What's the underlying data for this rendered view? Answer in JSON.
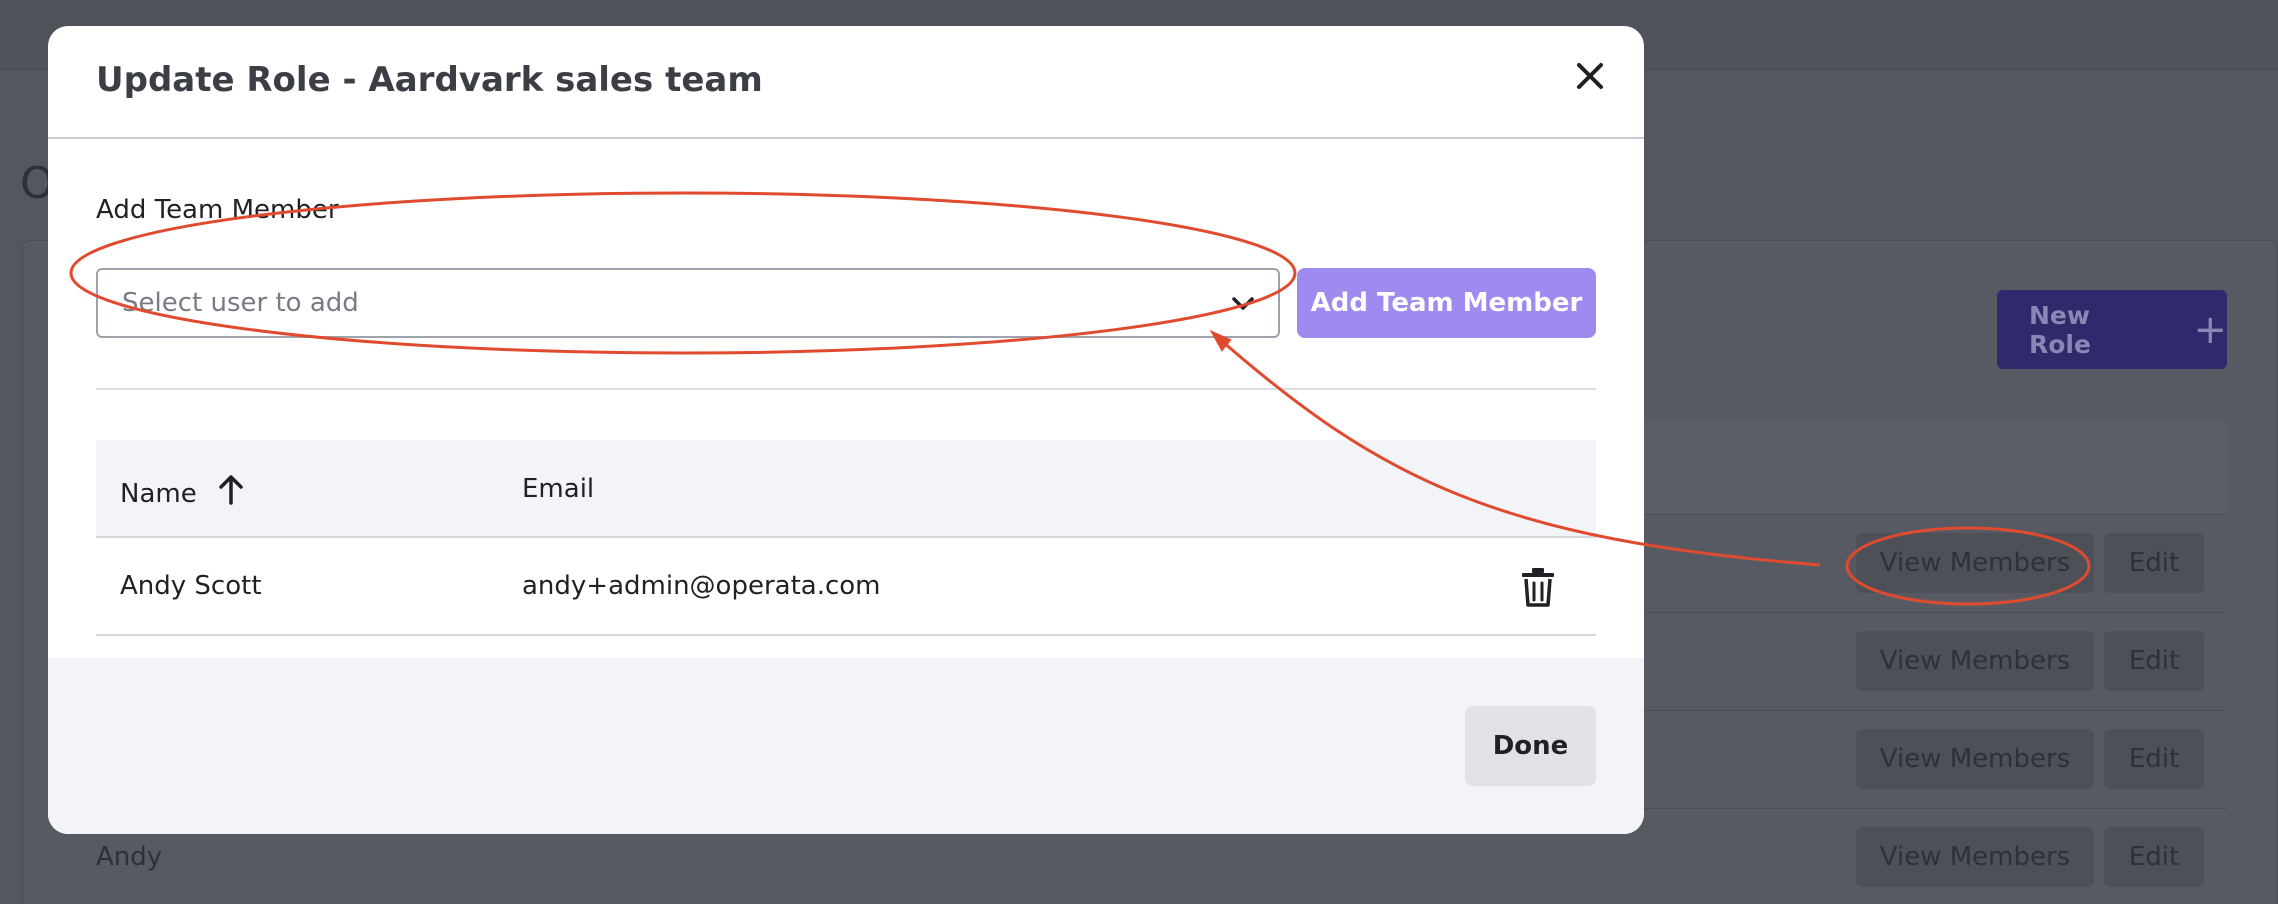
{
  "background": {
    "page_title_fragment": "O",
    "new_role_label": "New Role",
    "new_role_icon": "plus-icon",
    "rows": [
      {
        "name": "",
        "view_members_label": "View Members",
        "edit_label": "Edit"
      },
      {
        "name": "",
        "view_members_label": "View Members",
        "edit_label": "Edit"
      },
      {
        "name": "",
        "view_members_label": "View Members",
        "edit_label": "Edit"
      },
      {
        "name": "Andy",
        "view_members_label": "View Members",
        "edit_label": "Edit"
      }
    ]
  },
  "modal": {
    "title": "Update Role - Aardvark sales team",
    "close_icon": "close-icon",
    "field_label": "Add Team Member",
    "select_placeholder": "Select user to add",
    "add_button_label": "Add Team Member",
    "table": {
      "columns": {
        "name": "Name",
        "email": "Email"
      },
      "sort": {
        "column": "name",
        "direction": "ascending",
        "icon": "arrow-up-icon"
      },
      "rows": [
        {
          "name": "Andy Scott",
          "email": "andy+admin@operata.com",
          "delete_icon": "trash-icon"
        }
      ]
    },
    "done_label": "Done"
  },
  "colors": {
    "accent": "#9f8af0",
    "bg_primary_button": "#2e2a6b",
    "annotation": "#e04a2f"
  }
}
